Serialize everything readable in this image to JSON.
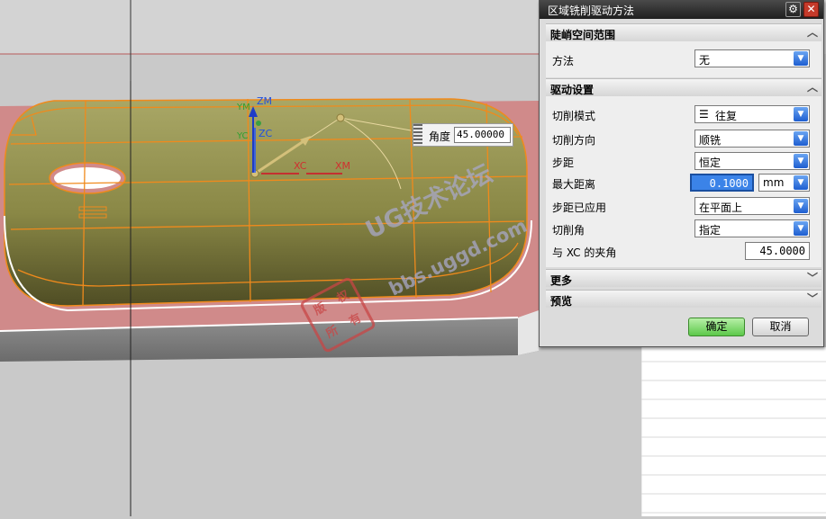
{
  "viewport": {
    "axis_labels": {
      "zm": "ZM",
      "zc": "ZC",
      "ym": "YM",
      "yc": "YC",
      "xc": "XC",
      "xm": "XM"
    },
    "angle_widget": {
      "label": "角度",
      "value": "45.00000"
    },
    "watermark": {
      "main": "UG技术论坛",
      "url": "bbs.uggd.com",
      "seal": [
        "版",
        "权",
        "所",
        "有"
      ]
    },
    "colors": {
      "part": "#7a7a3a",
      "blank": "#d08a8a",
      "toolpath": "#f08a1c",
      "background": "#c9c9c9"
    }
  },
  "dialog": {
    "title": "区域铣削驱动方法",
    "title_icons": [
      "gear-icon",
      "close-icon"
    ],
    "sections": {
      "steep": {
        "title": "陡峭空间范围",
        "expanded": true,
        "method_label": "方法",
        "method_value": "无"
      },
      "drive": {
        "title": "驱动设置",
        "expanded": true,
        "cut_pattern_label": "切削模式",
        "cut_pattern_value": "往复",
        "cut_direction_label": "切削方向",
        "cut_direction_value": "顺铣",
        "stepover_label": "步距",
        "stepover_value": "恒定",
        "max_distance_label": "最大距离",
        "max_distance_value": "0.1000",
        "max_distance_unit": "mm",
        "stepover_applied_label": "步距已应用",
        "stepover_applied_value": "在平面上",
        "cut_angle_label": "切削角",
        "cut_angle_value": "指定",
        "xc_angle_label": "与 XC 的夹角",
        "xc_angle_value": "45.0000"
      },
      "more": {
        "title": "更多",
        "expanded": false
      },
      "preview": {
        "title": "预览",
        "expanded": false
      }
    },
    "buttons": {
      "ok": "确定",
      "cancel": "取消"
    }
  }
}
